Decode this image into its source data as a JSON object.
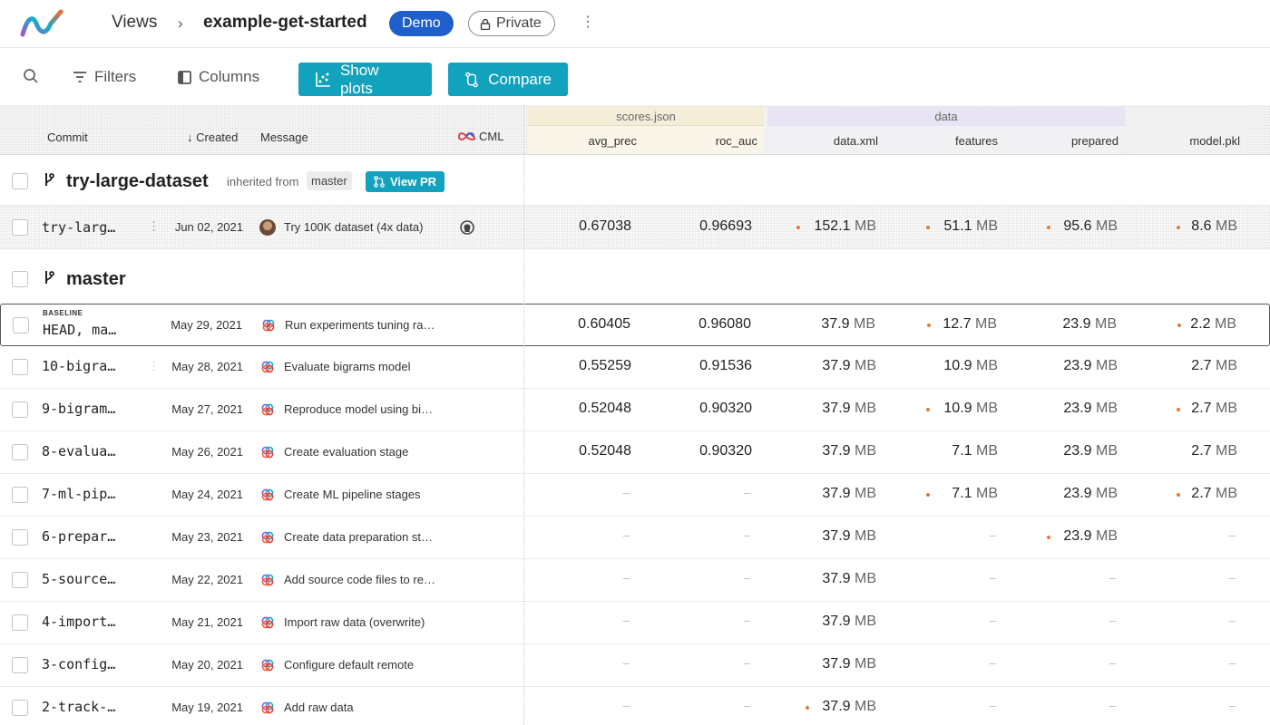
{
  "header": {
    "breadcrumb_views": "Views",
    "breadcrumb_sep": "›",
    "project": "example-get-started",
    "badge_demo": "Demo",
    "badge_private": "Private",
    "more": "⋮"
  },
  "toolbar": {
    "filters": "Filters",
    "columns": "Columns",
    "show_plots": "Show plots",
    "compare": "Compare"
  },
  "columns": {
    "commit": "Commit",
    "created": "Created",
    "created_sort_arrow": "↓",
    "message": "Message",
    "cml": "CML",
    "group_scores": "scores.json",
    "group_data": "data",
    "avg_prec": "avg_prec",
    "roc_auc": "roc_auc",
    "data_xml": "data.xml",
    "features": "features",
    "prepared": "prepared",
    "model_pkl": "model.pkl"
  },
  "branches": {
    "experiment": {
      "name": "try-large-dataset",
      "inherited_label": "inherited from",
      "inherited_branch": "master",
      "view_pr": "View PR"
    },
    "main": {
      "name": "master"
    }
  },
  "experiment_row": {
    "commit": "try-larg…",
    "date": "Jun 02, 2021",
    "message": "Try 100K dataset (4x data)",
    "avg_prec": "0.67038",
    "roc_auc": "0.96693",
    "data_xml": {
      "v": "152.1",
      "u": "MB"
    },
    "features": {
      "v": "51.1",
      "u": "MB"
    },
    "prepared": {
      "v": "95.6",
      "u": "MB"
    },
    "model_pkl": {
      "v": "8.6",
      "u": "MB"
    }
  },
  "baseline_label": "BASELINE",
  "rows": [
    {
      "commit": "HEAD, ma…",
      "date": "May 29, 2021",
      "message": "Run experiments tuning ra…",
      "avg_prec": "0.60405",
      "roc_auc": "0.96080",
      "data_xml": "37.9",
      "features": "12.7",
      "prepared": "23.9",
      "model_pkl": "2.2",
      "unit": "MB",
      "dash": "–"
    },
    {
      "commit": "10-bigra…",
      "date": "May 28, 2021",
      "message": "Evaluate bigrams model",
      "avg_prec": "0.55259",
      "roc_auc": "0.91536",
      "data_xml": "37.9",
      "features": "10.9",
      "prepared": "23.9",
      "model_pkl": "2.7",
      "unit": "MB",
      "dash": "–"
    },
    {
      "commit": "9-bigram…",
      "date": "May 27, 2021",
      "message": "Reproduce model using bi…",
      "avg_prec": "0.52048",
      "roc_auc": "0.90320",
      "data_xml": "37.9",
      "features": "10.9",
      "prepared": "23.9",
      "model_pkl": "2.7",
      "unit": "MB",
      "dash": "–"
    },
    {
      "commit": "8-evalua…",
      "date": "May 26, 2021",
      "message": "Create evaluation stage",
      "avg_prec": "0.52048",
      "roc_auc": "0.90320",
      "data_xml": "37.9",
      "features": "7.1",
      "prepared": "23.9",
      "model_pkl": "2.7",
      "unit": "MB",
      "dash": "–"
    },
    {
      "commit": "7-ml-pip…",
      "date": "May 24, 2021",
      "message": "Create ML pipeline stages",
      "avg_prec": "–",
      "roc_auc": "–",
      "data_xml": "37.9",
      "features": "7.1",
      "prepared": "23.9",
      "model_pkl": "2.7",
      "unit": "MB",
      "dash": "–"
    },
    {
      "commit": "6-prepar…",
      "date": "May 23, 2021",
      "message": "Create data preparation st…",
      "avg_prec": "–",
      "roc_auc": "–",
      "data_xml": "37.9",
      "features": "–",
      "prepared": "23.9",
      "model_pkl": "–",
      "unit": "MB",
      "dash": "–"
    },
    {
      "commit": "5-source…",
      "date": "May 22, 2021",
      "message": "Add source code files to re…",
      "avg_prec": "–",
      "roc_auc": "–",
      "data_xml": "37.9",
      "features": "–",
      "prepared": "–",
      "model_pkl": "–",
      "unit": "MB",
      "dash": "–"
    },
    {
      "commit": "4-import…",
      "date": "May 21, 2021",
      "message": "Import raw data (overwrite)",
      "avg_prec": "–",
      "roc_auc": "–",
      "data_xml": "37.9",
      "features": "–",
      "prepared": "–",
      "model_pkl": "–",
      "unit": "MB",
      "dash": "–"
    },
    {
      "commit": "3-config…",
      "date": "May 20, 2021",
      "message": "Configure default remote",
      "avg_prec": "–",
      "roc_auc": "–",
      "data_xml": "37.9",
      "features": "–",
      "prepared": "–",
      "model_pkl": "–",
      "unit": "MB",
      "dash": "–"
    },
    {
      "commit": "2-track-…",
      "date": "May 19, 2021",
      "message": "Add raw data",
      "avg_prec": "–",
      "roc_auc": "–",
      "data_xml": "37.9",
      "features": "–",
      "prepared": "–",
      "model_pkl": "–",
      "unit": "MB",
      "dash": "–"
    }
  ],
  "colors": {
    "accent": "#13a2bd",
    "demo_badge": "#1e5fcc",
    "changed_dot": "#e07b39",
    "scores_group": "#f4eed9",
    "data_group": "#e9e4f3"
  },
  "icons": {
    "logo": "dvc-studio-logo",
    "search": "search-icon",
    "filter": "filter-icon",
    "columns": "columns-icon",
    "plots": "scatter-plot-icon",
    "compare": "compare-icon",
    "branch": "git-branch-icon",
    "pull_request": "pull-request-icon",
    "github": "github-icon",
    "lock": "lock-icon",
    "cml": "cml-infinity-icon"
  }
}
